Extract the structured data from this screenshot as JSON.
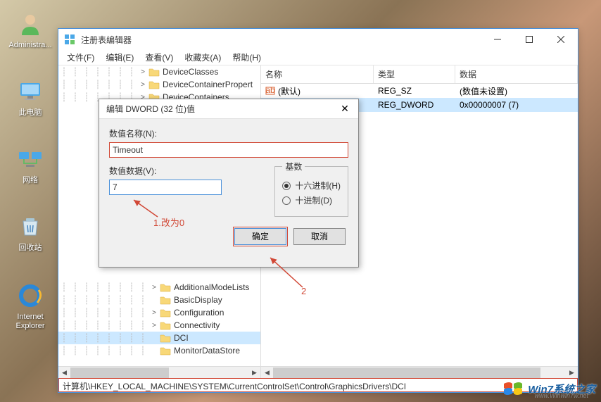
{
  "desktop": {
    "icons": [
      {
        "label": "Administra..."
      },
      {
        "label": "此电脑"
      },
      {
        "label": "网络"
      },
      {
        "label": "回收站"
      },
      {
        "label": "Internet\nExplorer"
      }
    ]
  },
  "window": {
    "title": "注册表编辑器",
    "menus": [
      "文件(F)",
      "编辑(E)",
      "查看(V)",
      "收藏夹(A)",
      "帮助(H)"
    ]
  },
  "tree": {
    "top_nodes": [
      {
        "label": "DeviceClasses",
        "exp": ">"
      },
      {
        "label": "DeviceContainerPropert",
        "exp": ">"
      },
      {
        "label": "DeviceContainers",
        "exp": ">"
      }
    ],
    "bottom_nodes": [
      {
        "label": "AdditionalModeLists",
        "exp": ">"
      },
      {
        "label": "BasicDisplay",
        "exp": ""
      },
      {
        "label": "Configuration",
        "exp": ">"
      },
      {
        "label": "Connectivity",
        "exp": ">"
      },
      {
        "label": "DCI",
        "exp": "",
        "selected": true
      },
      {
        "label": "MonitorDataStore",
        "exp": ""
      }
    ]
  },
  "list": {
    "cols": [
      "名称",
      "类型",
      "数据"
    ],
    "rows": [
      {
        "icon": "ab",
        "name": "(默认)",
        "type": "REG_SZ",
        "data": "(数值未设置)",
        "selected": false
      },
      {
        "icon": "01",
        "name": "",
        "type": "REG_DWORD",
        "data": "0x00000007 (7)",
        "selected": true
      }
    ]
  },
  "statusbar": "计算机\\HKEY_LOCAL_MACHINE\\SYSTEM\\CurrentControlSet\\Control\\GraphicsDrivers\\DCI",
  "dialog": {
    "title": "编辑 DWORD (32 位)值",
    "name_label": "数值名称(N):",
    "name_value": "Timeout",
    "data_label": "数值数据(V):",
    "data_value": "7",
    "radix_label": "基数",
    "radix_hex": "十六进制(H)",
    "radix_dec": "十进制(D)",
    "ok": "确定",
    "cancel": "取消"
  },
  "annotations": {
    "a1": "1.改为0",
    "a2": "2"
  },
  "watermark": {
    "text": "Win7系统之家",
    "url": "www.Winwin7w.net"
  }
}
